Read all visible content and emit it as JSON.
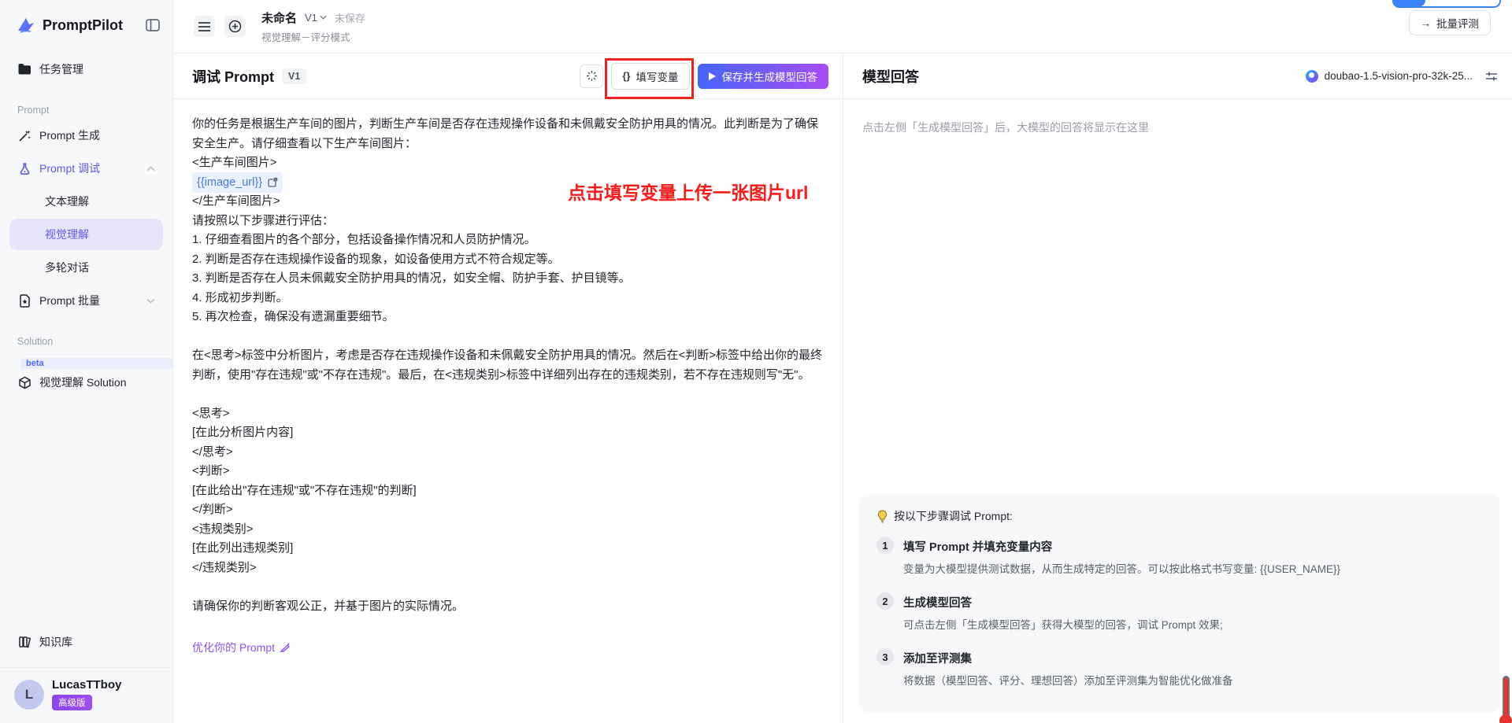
{
  "sidebar": {
    "brand": "PromptPilot",
    "sections": {
      "prompt": "Prompt",
      "solution": "Solution"
    },
    "items": {
      "task_mgmt": "任务管理",
      "prompt_gen": "Prompt 生成",
      "prompt_debug": "Prompt 调试",
      "sub_text": "文本理解",
      "sub_vision": "视觉理解",
      "sub_multiturn": "多轮对话",
      "prompt_batch": "Prompt 批量",
      "vision_solution": "视觉理解 Solution",
      "beta_badge": "beta",
      "knowledge_base": "知识库"
    },
    "user": {
      "name": "LucasTTboy",
      "badge": "高级版",
      "avatar_letter": "L"
    }
  },
  "topbar": {
    "doc_title": "未命名",
    "version": "V1",
    "unsaved": "未保存",
    "subtitle": "视觉理解－评分模式",
    "batch_eval": "批量评测"
  },
  "left_panel": {
    "title": "调试 Prompt",
    "version_badge": "V1",
    "fill_vars_label": "填写变量",
    "save_generate_label": "保存并生成模型回答",
    "annotation": "点击填写变量上传一张图片url",
    "optimize_link": "优化你的 Prompt",
    "prompt": {
      "part1": "你的任务是根据生产车间的图片，判断生产车间是否存在违规操作设备和未佩戴安全防护用具的情况。此判断是为了确保安全生产。请仔细查看以下生产车间图片：\n<生产车间图片>",
      "variable_chip": "{{image_url}}",
      "part2": "</生产车间图片>\n请按照以下步骤进行评估：\n1. 仔细查看图片的各个部分，包括设备操作情况和人员防护情况。\n2. 判断是否存在违规操作设备的现象，如设备使用方式不符合规定等。\n3. 判断是否存在人员未佩戴安全防护用具的情况，如安全帽、防护手套、护目镜等。\n4. 形成初步判断。\n5. 再次检查，确保没有遗漏重要细节。\n\n在<思考>标签中分析图片，考虑是否存在违规操作设备和未佩戴安全防护用具的情况。然后在<判断>标签中给出你的最终判断，使用\"存在违规\"或\"不存在违规\"。最后，在<违规类别>标签中详细列出存在的违规类别，若不存在违规则写\"无\"。\n\n<思考>\n[在此分析图片内容]\n</思考>\n<判断>\n[在此给出\"存在违规\"或\"不存在违规\"的判断]\n</判断>\n<违规类别>\n[在此列出违规类别]\n</违规类别>\n\n请确保你的判断客观公正，并基于图片的实际情况。"
    }
  },
  "right_panel": {
    "title": "模型回答",
    "model_name": "doubao-1.5-vision-pro-32k-25...",
    "placeholder": "点击左侧「生成模型回答」后，大模型的回答将显示在这里",
    "guide": {
      "title": "按以下步骤调试 Prompt:",
      "steps": [
        {
          "num": "1",
          "title": "填写 Prompt 并填充变量内容",
          "desc": "变量为大模型提供测试数据，从而生成特定的回答。可以按此格式书写变量: {{USER_NAME}}"
        },
        {
          "num": "2",
          "title": "生成模型回答",
          "desc": "可点击左侧「生成模型回答」获得大模型的回答，调试 Prompt 效果;"
        },
        {
          "num": "3",
          "title": "添加至评测集",
          "desc": "将数据（模型回答、评分、理想回答）添加至评测集为智能优化做准备"
        }
      ]
    }
  },
  "icons": {
    "braces": "{}",
    "arrow_right": "→"
  },
  "colors": {
    "accent_purple": "#6355f2",
    "save_gradient_start": "#4566f8",
    "save_gradient_end": "#a64df3",
    "annotation_red": "#fa1a1a",
    "premium_badge": "#8a45f0",
    "selected_bg": "#e7e5fc",
    "sidebar_bg": "#f7f8fa"
  }
}
